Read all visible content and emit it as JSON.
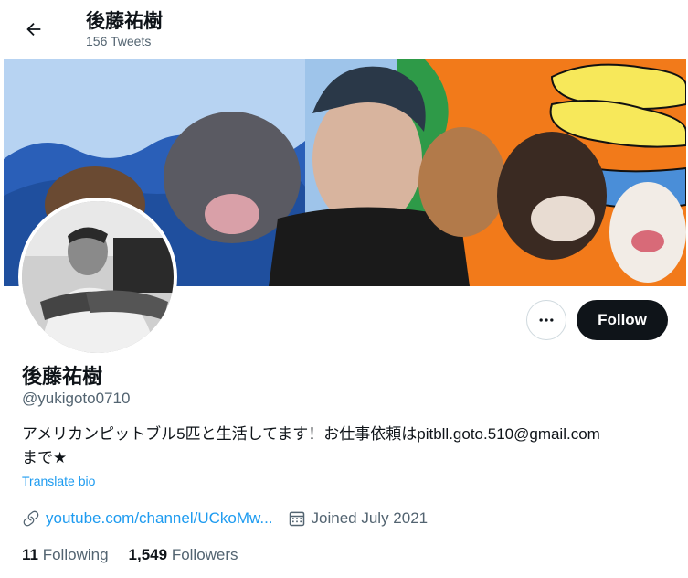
{
  "header": {
    "title": "後藤祐樹",
    "tweet_count": "156 Tweets"
  },
  "profile": {
    "name": "後藤祐樹",
    "handle": "@yukigoto0710",
    "bio_line1": "アメリカンピットブル5匹と生活してます！お仕事依頼はpitbll.goto.510@gmail.com",
    "bio_line2": "まで★",
    "translate_label": "Translate bio",
    "website": "youtube.com/channel/UCkoMw...",
    "joined": "Joined July 2021",
    "following_count": "11",
    "following_label": "Following",
    "followers_count": "1,549",
    "followers_label": "Followers"
  },
  "actions": {
    "follow_label": "Follow"
  },
  "colors": {
    "accent": "#1d9bf0",
    "text": "#0f1419",
    "muted": "#536471",
    "follow_bg": "#0f1419"
  },
  "icons": [
    "back-arrow-icon",
    "more-icon",
    "link-icon",
    "calendar-icon"
  ]
}
